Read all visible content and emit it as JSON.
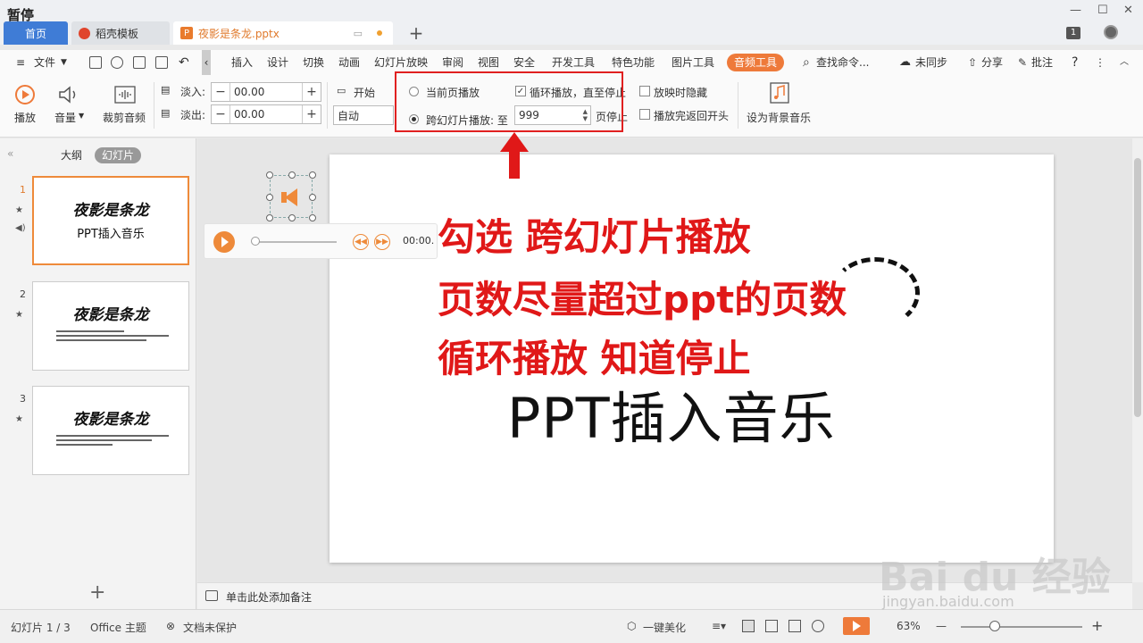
{
  "titlebar": {
    "paused": "暂停",
    "tab_home": "首页",
    "tab_template": "稻壳模板",
    "tab_file": "夜影是条龙.pptx",
    "tab_plus": "+",
    "window_controls": [
      "—",
      "☐",
      "✕"
    ],
    "badge": "1"
  },
  "menu": {
    "file": "文件",
    "items": [
      "插入",
      "设计",
      "切换",
      "动画",
      "幻灯片放映",
      "审阅",
      "视图",
      "安全",
      "开发工具",
      "特色功能",
      "图片工具"
    ],
    "audio_tools": "音频工具",
    "search": "查找命令...",
    "sync": "未同步",
    "share": "分享",
    "comment": "批注"
  },
  "ribbon": {
    "play": "播放",
    "volume": "音量",
    "trim": "裁剪音频",
    "fade_in": "淡入:",
    "fade_in_value": "00.00",
    "fade_out": "淡出:",
    "fade_out_value": "00.00",
    "start": "开始",
    "start_value": "自动",
    "current_page": "当前页播放",
    "cross_slide": "跨幻灯片播放: 至",
    "cross_value": "999",
    "page_stop": "页停止",
    "loop": "循环播放，直至停止",
    "hide_on_show": "放映时隐藏",
    "rewind": "播放完返回开头",
    "set_bg_music": "设为背景音乐"
  },
  "leftpanel": {
    "outline": "大纲",
    "slides": "幻灯片",
    "thumbs": [
      {
        "num": "1",
        "title": "夜影是条龙",
        "sub": "PPT插入音乐"
      },
      {
        "num": "2",
        "title": "夜影是条龙"
      },
      {
        "num": "3",
        "title": "夜影是条龙"
      }
    ],
    "add": "+"
  },
  "slide": {
    "title": "PPT插入音乐",
    "annotations": [
      "勾选 跨幻灯片播放",
      "页数尽量超过ppt的页数",
      "循环播放 知道停止"
    ],
    "player_time": "00:00."
  },
  "notes": {
    "placeholder": "单击此处添加备注"
  },
  "status": {
    "slide_info": "幻灯片 1 / 3",
    "theme": "Office 主题",
    "protect": "文档未保护",
    "beautify": "一键美化",
    "zoom": "63%",
    "minus": "—",
    "plus": "+"
  },
  "watermark": {
    "brand": "Bai du 经验",
    "url": "jingyan.baidu.com"
  },
  "colors": {
    "accent": "#ee7a3a",
    "annotation": "#e01818",
    "home_tab": "#3f7cd6"
  }
}
